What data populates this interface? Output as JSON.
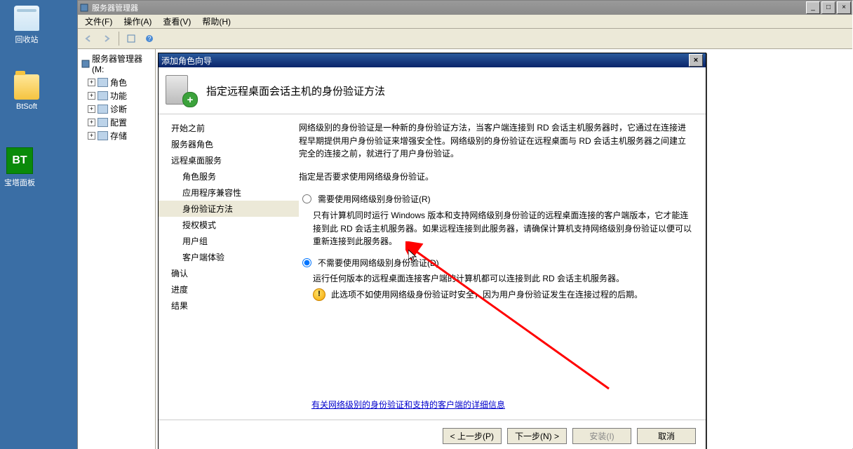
{
  "desktop": {
    "recycle_label": "回收站",
    "btsoft_label": "BtSoft",
    "btpanel_label": "宝塔面板"
  },
  "server_manager": {
    "title": "服务器管理器",
    "menu": {
      "file": "文件(F)",
      "action": "操作(A)",
      "view": "查看(V)",
      "help": "帮助(H)"
    },
    "tree": {
      "root": "服务器管理器 (M:",
      "roles": "角色",
      "features": "功能",
      "diagnostics": "诊断",
      "config": "配置",
      "storage": "存储"
    },
    "winbtn": {
      "min": "_",
      "max": "□",
      "close": "×"
    }
  },
  "wizard": {
    "title": "添加角色向导",
    "heading": "指定远程桌面会话主机的身份验证方法",
    "nav": {
      "before": "开始之前",
      "roles": "服务器角色",
      "rds": "远程桌面服务",
      "role_svc": "角色服务",
      "app_compat": "应用程序兼容性",
      "auth": "身份验证方法",
      "license": "授权模式",
      "users": "用户组",
      "client_exp": "客户端体验",
      "confirm": "确认",
      "progress": "进度",
      "result": "结果"
    },
    "intro": "网络级别的身份验证是一种新的身份验证方法，当客户端连接到 RD 会话主机服务器时，它通过在连接进程早期提供用户身份验证来增强安全性。网络级别的身份验证在远程桌面与 RD 会话主机服务器之间建立完全的连接之前，就进行了用户身份验证。",
    "specify": "指定是否要求使用网络级身份验证。",
    "opt1_label": "需要使用网络级别身份验证(R)",
    "opt1_desc": "只有计算机同时运行 Windows 版本和支持网络级别身份验证的远程桌面连接的客户端版本，它才能连接到此 RD 会话主机服务器。如果远程连接到此服务器，请确保计算机支持网络级别身份验证以便可以重新连接到此服务器。",
    "opt2_label": "不需要使用网络级别身份验证(D)",
    "opt2_desc": "运行任何版本的远程桌面连接客户端的计算机都可以连接到此 RD 会话主机服务器。",
    "warn": "此选项不如使用网络级身份验证时安全，因为用户身份验证发生在连接过程的后期。",
    "link": "有关网络级别的身份验证和支持的客户端的详细信息",
    "buttons": {
      "prev": "< 上一步(P)",
      "next": "下一步(N) >",
      "install": "安装(I)",
      "cancel": "取消"
    }
  }
}
